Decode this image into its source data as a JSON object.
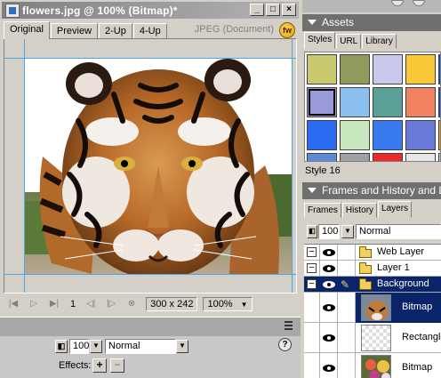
{
  "document": {
    "title": "flowers.jpg @ 100% (Bitmap)*",
    "tabs": [
      "Original",
      "Preview",
      "2-Up",
      "4-Up"
    ],
    "active_tab": "Original",
    "format_info": "JPEG (Document)",
    "logo_text": "fw",
    "window_buttons": [
      "_",
      "□",
      "×"
    ],
    "status": {
      "page": "1",
      "dimensions": "300 x 242",
      "zoom": "100%"
    }
  },
  "properties": {
    "opacity": "100",
    "blend_mode": "Normal",
    "effects_label": "Effects:",
    "add_effect": "+",
    "remove_effect": "−",
    "help": "?"
  },
  "assets": {
    "header": "Assets",
    "tabs": [
      "Styles",
      "URL",
      "Library"
    ],
    "active_tab": "Styles",
    "selected_style": "Style 16",
    "swatch_colors": [
      "#c8c86e",
      "#909a5c",
      "#c8c8ec",
      "#f8c838",
      "#1a4ab8",
      "#9a9ad8",
      "#8cc0f0",
      "#5aa096",
      "#f08260",
      "#1a4ab8",
      "#2a6af0",
      "#c8e8c0",
      "#3a7af0",
      "#6a7ad8",
      "#f0a030",
      "#5a8ad8",
      "#a0a0a0",
      "#f02828",
      "#e8e8e8",
      "#c8c8c8"
    ]
  },
  "frames_history_layers": {
    "header": "Frames and History and Layers",
    "tabs": [
      "Frames",
      "History",
      "Layers"
    ],
    "active_tab": "Layers",
    "opacity": "100",
    "blend_mode": "Normal",
    "layers": [
      {
        "name": "Web Layer",
        "type": "folder"
      },
      {
        "name": "Layer 1",
        "type": "folder"
      },
      {
        "name": "Background",
        "type": "folder",
        "selected": true
      },
      {
        "name": "Bitmap",
        "type": "object",
        "selected": true
      },
      {
        "name": "Rectangle",
        "type": "object"
      },
      {
        "name": "Bitmap",
        "type": "object"
      }
    ]
  }
}
